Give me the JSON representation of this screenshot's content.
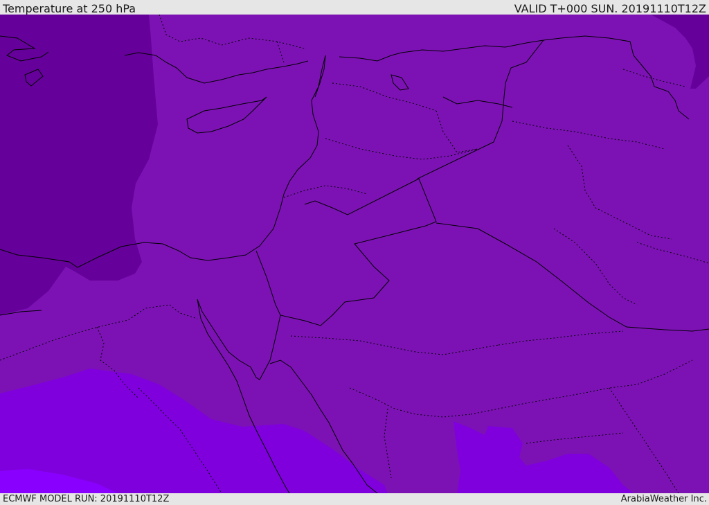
{
  "header": {
    "title": "Temperature at 250 hPa",
    "valid": "VALID T+000 SUN. 20191110T12Z"
  },
  "footer": {
    "model_run": "ECMWF MODEL RUN: 20191110T12Z",
    "credit": "ArabiaWeather Inc."
  },
  "colors": {
    "background_field": "#7c12b4",
    "cold_core": "#65019a",
    "warm_band": "#7f00dd",
    "warmest": "#8a00ff",
    "coast": "#000000",
    "header_bg": "#e6e6e6"
  }
}
